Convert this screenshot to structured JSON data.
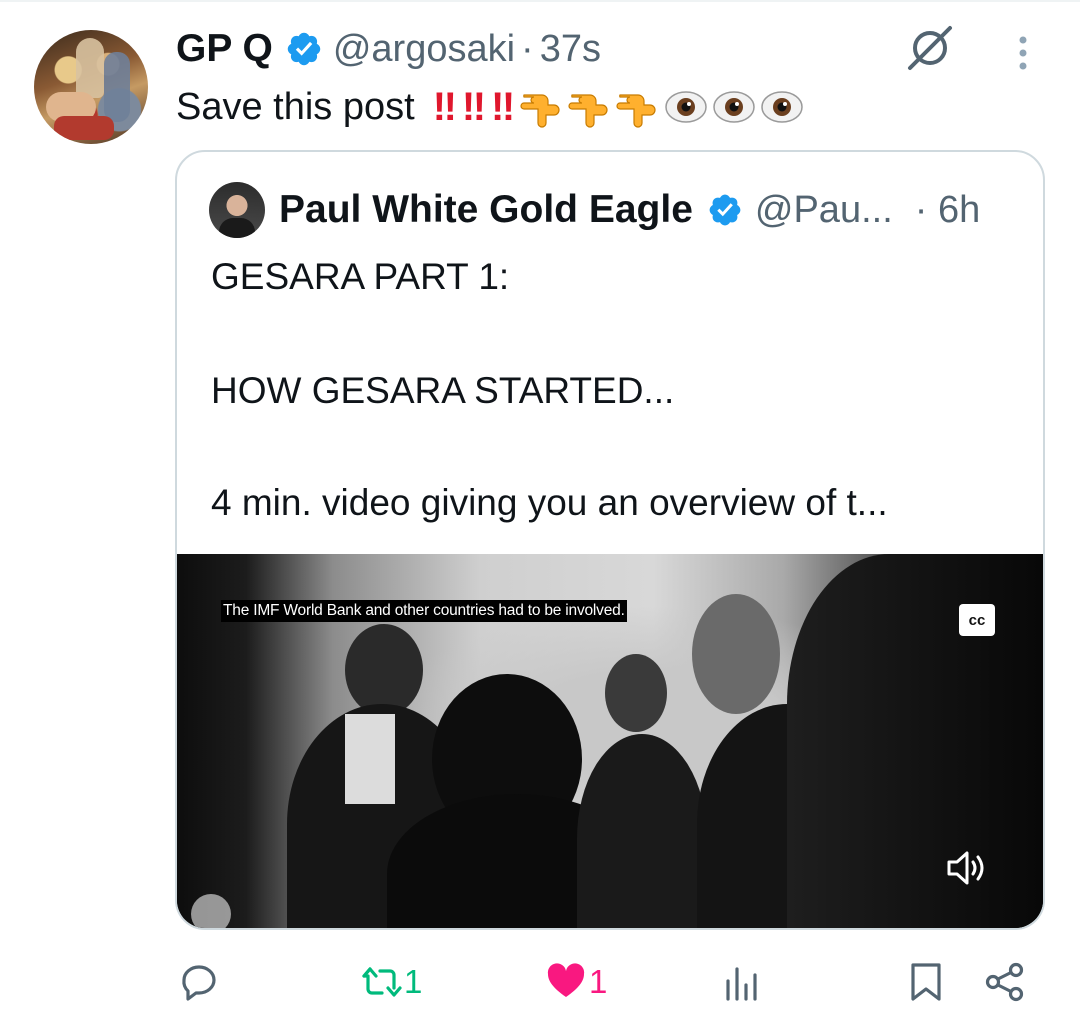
{
  "tweet": {
    "author": {
      "name": "GP Q",
      "handle": "@argosaki",
      "time": "37s"
    },
    "text": "Save this post",
    "emoji": {
      "bangs": [
        "‼",
        "‼",
        "‼"
      ],
      "hands": 3,
      "eyes": 3
    }
  },
  "quoted": {
    "author": {
      "name": "Paul White Gold Eagle",
      "handle": "@Pau...",
      "time": "· 6h"
    },
    "lines": [
      "GESARA PART 1:",
      "HOW GESARA STARTED...",
      "4 min. video giving you an overview of t..."
    ],
    "video": {
      "caption": "The IMF World Bank and other countries had to be involved.",
      "cc_label": "cc"
    }
  },
  "actions": {
    "reply": {
      "icon": "reply-icon",
      "count": ""
    },
    "repost": {
      "icon": "repost-icon",
      "count": "1",
      "color": "#00ba7c"
    },
    "like": {
      "icon": "heart-icon",
      "count": "1",
      "color": "#f91880"
    },
    "views": {
      "icon": "views-icon",
      "count": ""
    },
    "bookmark": {
      "icon": "bookmark-icon"
    },
    "share": {
      "icon": "share-icon"
    }
  },
  "colors": {
    "verified": "#1d9bf0",
    "muted": "#536471",
    "border": "#cfd9de"
  }
}
